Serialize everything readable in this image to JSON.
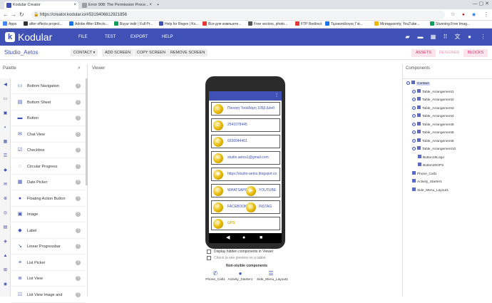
{
  "browser": {
    "tabs": [
      {
        "title": "Kodular Creator",
        "color": "#3f51b5"
      },
      {
        "title": "Error 908: The Permission Proce...",
        "color": "#9e9e9e"
      }
    ],
    "url": "https://creator.kodular.io/#5319406812921856",
    "bookmarks": [
      {
        "label": "Apps",
        "color": "#4285f4"
      },
      {
        "label": "after effects project...",
        "color": "#333333"
      },
      {
        "label": "Adobe After Effects...",
        "color": "#1a73e8"
      },
      {
        "label": "Buyur indir | Full Pr...",
        "color": "#0f9d58"
      },
      {
        "label": "Help for Regex | Ko...",
        "color": "#3f51b5"
      },
      {
        "label": "Вся для компьюте...",
        "color": "#e53935"
      },
      {
        "label": "Free vectors, photo...",
        "color": "#555555"
      },
      {
        "label": "FTP Redirect",
        "color": "#e53935"
      },
      {
        "label": "Τιμοκατάλογος Γιά...",
        "color": "#1a73e8"
      },
      {
        "label": "Μεταφραστής YouTube...",
        "color": "#f4b400"
      },
      {
        "label": "Stunning Free Imag...",
        "color": "#0f9d58"
      }
    ]
  },
  "app": {
    "brand": "Kodular",
    "menu": [
      "FILE",
      "TEST",
      "EXPORT",
      "HELP"
    ]
  },
  "project": {
    "name": "Studio_Aetos",
    "buttons": [
      "CONTACT ▾",
      "ADD SCREEN",
      "COPY SCREEN",
      "REMOVE SCREEN"
    ],
    "modes": [
      "ASSETS",
      "DESIGNER",
      "BLOCKS"
    ]
  },
  "palette": {
    "title": "Palette",
    "items": [
      {
        "label": "Bottom Navigation",
        "icon": "▭"
      },
      {
        "label": "Bottom Sheet",
        "icon": "▤"
      },
      {
        "label": "Button",
        "icon": "▬"
      },
      {
        "label": "Chat View",
        "icon": "✉"
      },
      {
        "label": "Checkbox",
        "icon": "☑"
      },
      {
        "label": "Circular Progress",
        "icon": "◌"
      },
      {
        "label": "Date Picker",
        "icon": "▦"
      },
      {
        "label": "Floating Action Button",
        "icon": "●"
      },
      {
        "label": "Image",
        "icon": "▣"
      },
      {
        "label": "Label",
        "icon": "◆"
      },
      {
        "label": "Linear Progressbar",
        "icon": "↘"
      },
      {
        "label": "List Picker",
        "icon": "≡"
      },
      {
        "label": "List View",
        "icon": "≣"
      },
      {
        "label": "List View Image and",
        "icon": "☷"
      }
    ],
    "help": "?"
  },
  "viewer": {
    "title": "Viewer",
    "rows": [
      {
        "text": "Παναγή Τσαλδάρη 105β Δάνθ",
        "icon": "⌂"
      },
      {
        "text": "2541078445",
        "icon": "✆"
      },
      {
        "text": "6936044401",
        "icon": "✆"
      },
      {
        "text": "studio.aetos1@gmail.com",
        "icon": "✉"
      },
      {
        "text": "https://studio-aetos.blogspot.co",
        "icon": "✺"
      },
      {
        "text": "WHATSAPP",
        "icon": "✆",
        "text2": "YOUTUBE",
        "icon2": "▶"
      },
      {
        "text": "FACEBOOK",
        "icon": "f",
        "text2": "INSTAG",
        "icon2": "◎"
      },
      {
        "text": "GPS",
        "icon": "⚲"
      }
    ],
    "options": [
      "Display hidden components in Viewer",
      "Check to see preview on a tablet"
    ],
    "nonvisible_title": "Non-visible components",
    "nonvisible": [
      {
        "label": "Phone_Call1",
        "icon": "✆"
      },
      {
        "label": "Activity_Starter1",
        "icon": "●"
      },
      {
        "label": "Side_Menu_Layout1",
        "icon": "☰"
      }
    ]
  },
  "components": {
    "title": "Components",
    "tree": [
      {
        "label": "Contact",
        "expander": "−"
      },
      {
        "label": "Table_Arrangement1",
        "expander": "+"
      },
      {
        "label": "Table_Arrangement2",
        "expander": "+"
      },
      {
        "label": "Table_Arrangement3",
        "expander": "+"
      },
      {
        "label": "Table_Arrangement4",
        "expander": "+"
      },
      {
        "label": "Table_Arrangement5",
        "expander": "+"
      },
      {
        "label": "Table_Arrangement6",
        "expander": "+"
      },
      {
        "label": "Table_Arrangement8",
        "expander": "+"
      },
      {
        "label": "Table_Arrangement10",
        "expander": "−"
      },
      {
        "label": "Button19Logo",
        "expander": ""
      },
      {
        "label": "Button20GPS",
        "expander": ""
      },
      {
        "label": "Phone_Call1",
        "expander": ""
      },
      {
        "label": "Activity_Starter1",
        "expander": ""
      },
      {
        "label": "Side_Menu_Layout1",
        "expander": ""
      }
    ]
  },
  "colors": {
    "primary": "#3f51b5",
    "mode_inactive": "#f48fb1"
  }
}
